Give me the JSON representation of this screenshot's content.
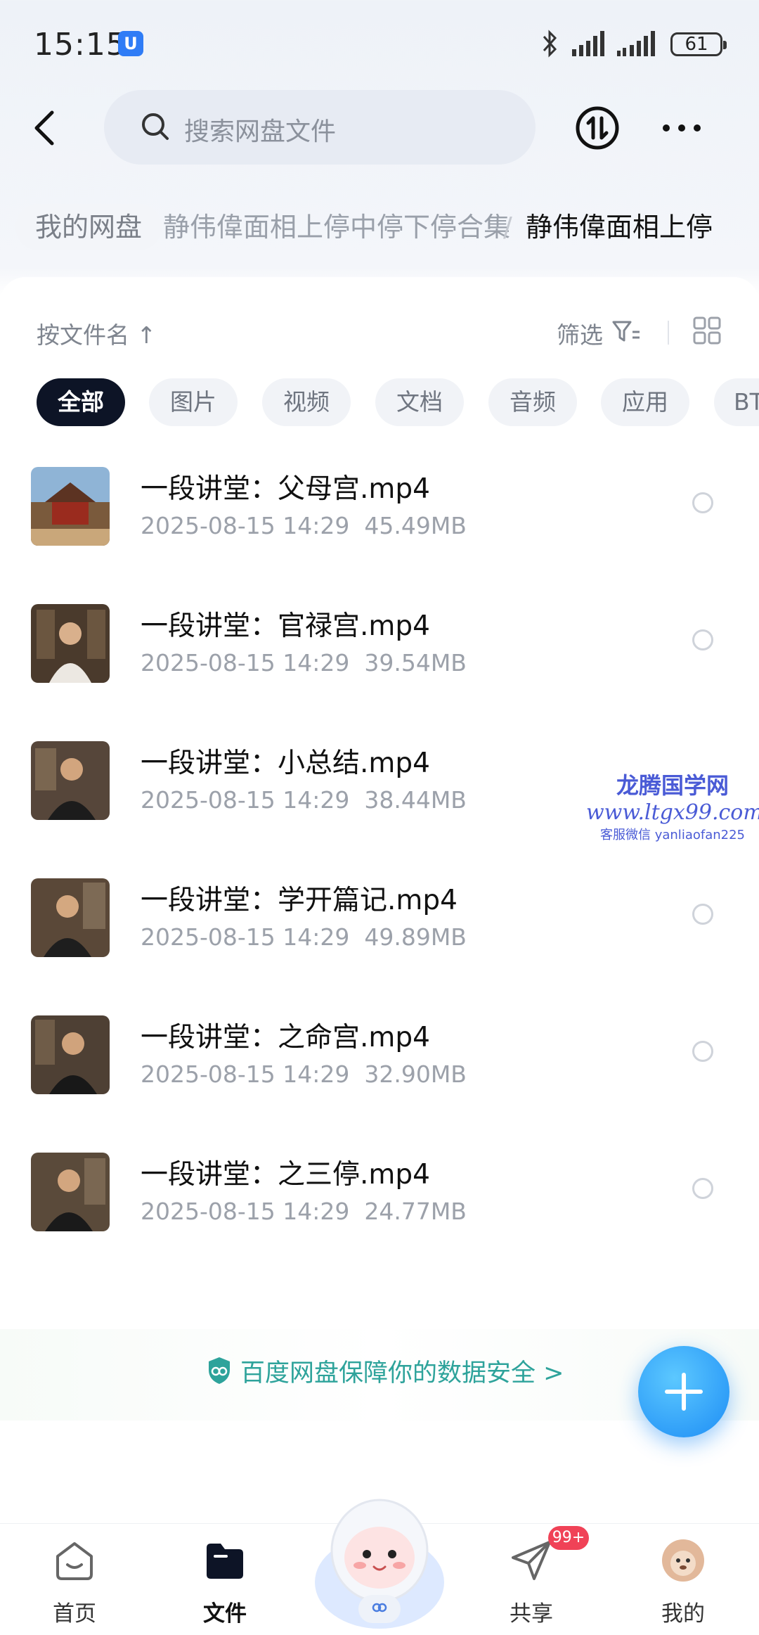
{
  "status_bar": {
    "time": "15:15",
    "battery": "61"
  },
  "search": {
    "placeholder": "搜索网盘文件"
  },
  "breadcrumb": {
    "root": "我的网盘",
    "middle": "静伟偉面相上停中停下停合集",
    "separator": "/",
    "current": "静伟偉面相上停"
  },
  "toolbar": {
    "sort_label": "按文件名 ↑",
    "filter_label": "筛选"
  },
  "chips": [
    "全部",
    "图片",
    "视频",
    "文档",
    "音频",
    "应用",
    "BT"
  ],
  "files": [
    {
      "name": "一段讲堂：父母宫.mp4",
      "date": "2025-08-15  14:29",
      "size": "45.49MB"
    },
    {
      "name": "一段讲堂：官禄宫.mp4",
      "date": "2025-08-15  14:29",
      "size": "39.54MB"
    },
    {
      "name": "一段讲堂：小总结.mp4",
      "date": "2025-08-15  14:29",
      "size": "38.44MB"
    },
    {
      "name": "一段讲堂：学开篇记.mp4",
      "date": "2025-08-15  14:29",
      "size": "49.89MB"
    },
    {
      "name": "一段讲堂：之命宫.mp4",
      "date": "2025-08-15  14:29",
      "size": "32.90MB"
    },
    {
      "name": "一段讲堂：之三停.mp4",
      "date": "2025-08-15  14:29",
      "size": "24.77MB"
    }
  ],
  "watermark": {
    "line1": "龙腾国学网",
    "line2": "www.ltgx99.com",
    "line3": "客服微信 yanliaofan225"
  },
  "safety_banner": "百度网盘保障你的数据安全 >",
  "tabs": [
    {
      "label": "首页"
    },
    {
      "label": "文件"
    },
    {
      "label": "共享"
    },
    {
      "label": "我的"
    }
  ],
  "share_badge": "99+",
  "colors": {
    "accent": "#1d8df5",
    "safety": "#2ea39b",
    "badge": "#f04257",
    "chip_active": "#0d1426"
  }
}
